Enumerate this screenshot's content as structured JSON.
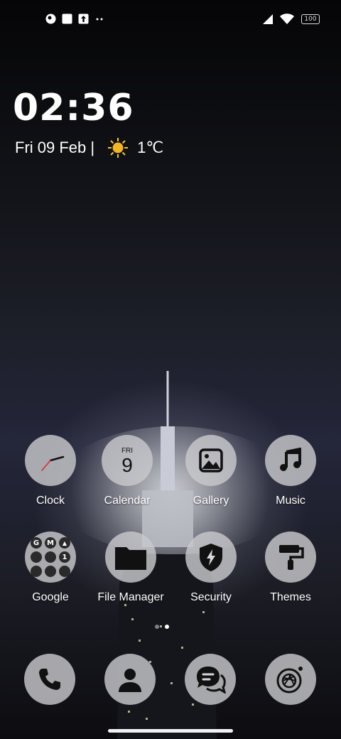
{
  "status_bar": {
    "battery": "100"
  },
  "lock_widget": {
    "time": "02:36",
    "date": "Fri 09 Feb |",
    "temperature": "1℃"
  },
  "apps": [
    {
      "label": "Clock"
    },
    {
      "label": "Calendar",
      "day_name": "FRI",
      "day_number": "9"
    },
    {
      "label": "Gallery"
    },
    {
      "label": "Music"
    },
    {
      "label": "Google",
      "folder_glyphs": [
        "G",
        "M",
        "▲",
        "",
        "",
        "1",
        "",
        "",
        ""
      ]
    },
    {
      "label": "File Manager"
    },
    {
      "label": "Security"
    },
    {
      "label": "Themes"
    }
  ],
  "dock": [
    {
      "icon": "phone-icon"
    },
    {
      "icon": "contacts-icon"
    },
    {
      "icon": "messages-icon"
    },
    {
      "icon": "camera-icon"
    }
  ],
  "page_indicator": {
    "pages": 2,
    "active": 1
  },
  "colors": {
    "icon_bg": "#c8c8cc",
    "icon_fg": "#111111"
  }
}
